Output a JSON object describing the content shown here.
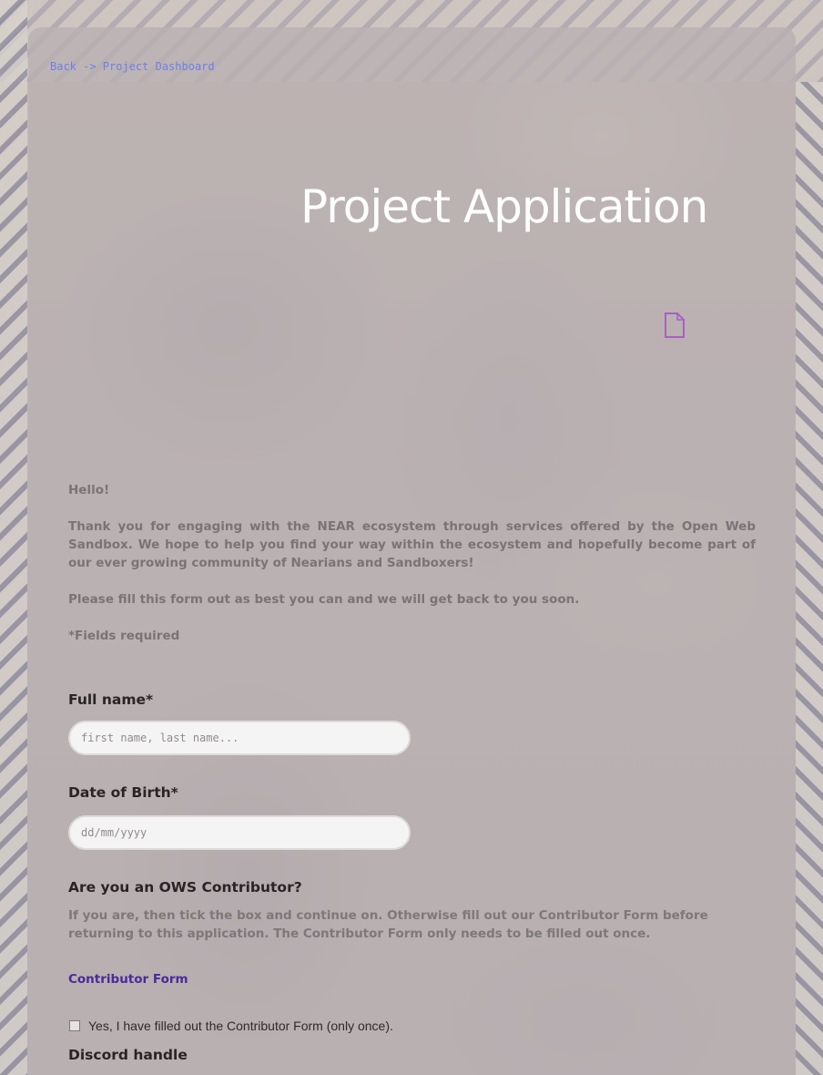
{
  "nav": {
    "back_link": "Back -> Project Dashboard"
  },
  "header": {
    "title": "Project Application",
    "icon": "document-icon"
  },
  "intro": {
    "greeting": "Hello!",
    "paragraph1": "Thank you for engaging with the NEAR ecosystem through services offered by the Open Web Sandbox. We hope to help you find your way within the ecosystem and hopefully become part of our ever growing community of Nearians and Sandboxers!",
    "paragraph2": "Please fill this form out as best you can and we will get back to you soon.",
    "required_note": "*Fields required"
  },
  "form": {
    "full_name": {
      "label": "Full name*",
      "placeholder": "first name, last name...",
      "value": ""
    },
    "date_of_birth": {
      "label": "Date of Birth*",
      "placeholder": "dd/mm/yyyy",
      "value": ""
    },
    "contributor": {
      "question": "Are you an OWS Contributor?",
      "help": "If you are, then tick the box and continue on. Otherwise fill out our Contributor Form before returning to this application. The Contributor Form only needs to be filled out once.",
      "link_label": "Contributor Form",
      "checkbox_label": "Yes, I have filled out the Contributor Form (only once).",
      "checked": false
    },
    "discord": {
      "label": "Discord handle"
    }
  },
  "colors": {
    "link": "#6e7fe6",
    "title": "#ffffff",
    "icon": "#a85fc4",
    "contributor_link": "#4b2a9a",
    "panel": "#b9b0b2"
  }
}
